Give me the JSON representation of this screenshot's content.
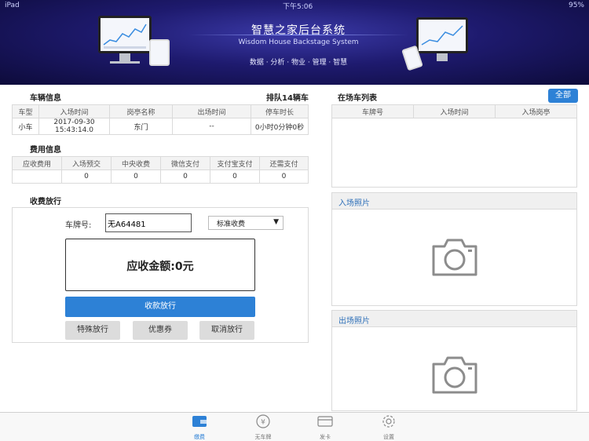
{
  "status_bar": {
    "left": "iPad",
    "time": "下午5:06",
    "battery": "95%"
  },
  "banner": {
    "title": "智慧之家后台系统",
    "subtitle": "Wisdom House Backstage System",
    "tags": "数据 · 分析 · 物业 · 管理 · 智慧"
  },
  "vehicle_info": {
    "title": "车辆信息",
    "queue": "排队14辆车",
    "headers": [
      "车型",
      "入场时间",
      "岗亭名称",
      "出场时间",
      "停车时长"
    ],
    "row": [
      "小车",
      "2017-09-30 15:43:14.0",
      "东门",
      "--",
      "0小时0分钟0秒"
    ]
  },
  "fee_info": {
    "title": "费用信息",
    "headers": [
      "应收费用",
      "入场预交",
      "中央收费",
      "微信支付",
      "支付宝支付",
      "还需支付"
    ],
    "row": [
      "",
      "0",
      "0",
      "0",
      "0",
      "0"
    ]
  },
  "release": {
    "title": "收费放行",
    "plate_label": "车牌号:",
    "plate_value": "无A64481",
    "mode": "标准收费",
    "mode_arrow": "▼",
    "amount_label": "应收金额:",
    "amount_value": "0元",
    "collect_button": "收款放行",
    "special_button": "特殊放行",
    "coupon_button": "优惠券",
    "cancel_button": "取消放行"
  },
  "onsite_list": {
    "title": "在场车列表",
    "all_button": "全部",
    "headers": [
      "车牌号",
      "入场时间",
      "入场岗亭"
    ]
  },
  "entry_photo": {
    "title": "入场照片"
  },
  "exit_photo": {
    "title": "出场照片"
  },
  "tabs": [
    {
      "label": "缴费",
      "icon": "wallet-icon",
      "active": true
    },
    {
      "label": "无车牌",
      "icon": "yuan-coin-icon",
      "active": false
    },
    {
      "label": "发卡",
      "icon": "card-icon",
      "active": false
    },
    {
      "label": "设置",
      "icon": "gear-icon",
      "active": false
    }
  ],
  "colors": {
    "accent": "#2d81d6",
    "banner_dark": "#0d0b3a",
    "banner_mid": "#3b3aa8"
  }
}
